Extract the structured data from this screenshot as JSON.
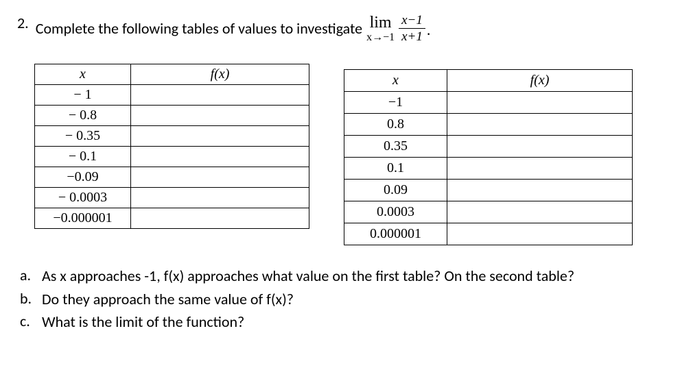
{
  "question": {
    "number": "2.",
    "text_before_limit": "Complete the following tables of values to investigate",
    "limit": {
      "lim_label": "lim",
      "approach": "x→−1",
      "numerator": "x−1",
      "denominator": "x+1"
    },
    "period": "."
  },
  "table1": {
    "headers": {
      "x": "x",
      "fx": "f(x)"
    },
    "rows": [
      {
        "x": "− 1",
        "fx": ""
      },
      {
        "x": "− 0.8",
        "fx": ""
      },
      {
        "x": "− 0.35",
        "fx": ""
      },
      {
        "x": "− 0.1",
        "fx": ""
      },
      {
        "x": "−0.09",
        "fx": ""
      },
      {
        "x": "− 0.0003",
        "fx": ""
      },
      {
        "x": "−0.000001",
        "fx": ""
      }
    ]
  },
  "table2": {
    "headers": {
      "x": "x",
      "fx": "f(x)"
    },
    "rows": [
      {
        "x": "−1",
        "fx": ""
      },
      {
        "x": "0.8",
        "fx": ""
      },
      {
        "x": "0.35",
        "fx": ""
      },
      {
        "x": "0.1",
        "fx": ""
      },
      {
        "x": "0.09",
        "fx": ""
      },
      {
        "x": "0.0003",
        "fx": ""
      },
      {
        "x": "0.000001",
        "fx": ""
      }
    ]
  },
  "subquestions": {
    "a": {
      "letter": "a.",
      "text": "As x approaches -1, f(x) approaches what value on the first table? On the second table?"
    },
    "b": {
      "letter": "b.",
      "text": "Do they approach the same value of f(x)?"
    },
    "c": {
      "letter": "c.",
      "text": "What is the limit of the function?"
    }
  }
}
